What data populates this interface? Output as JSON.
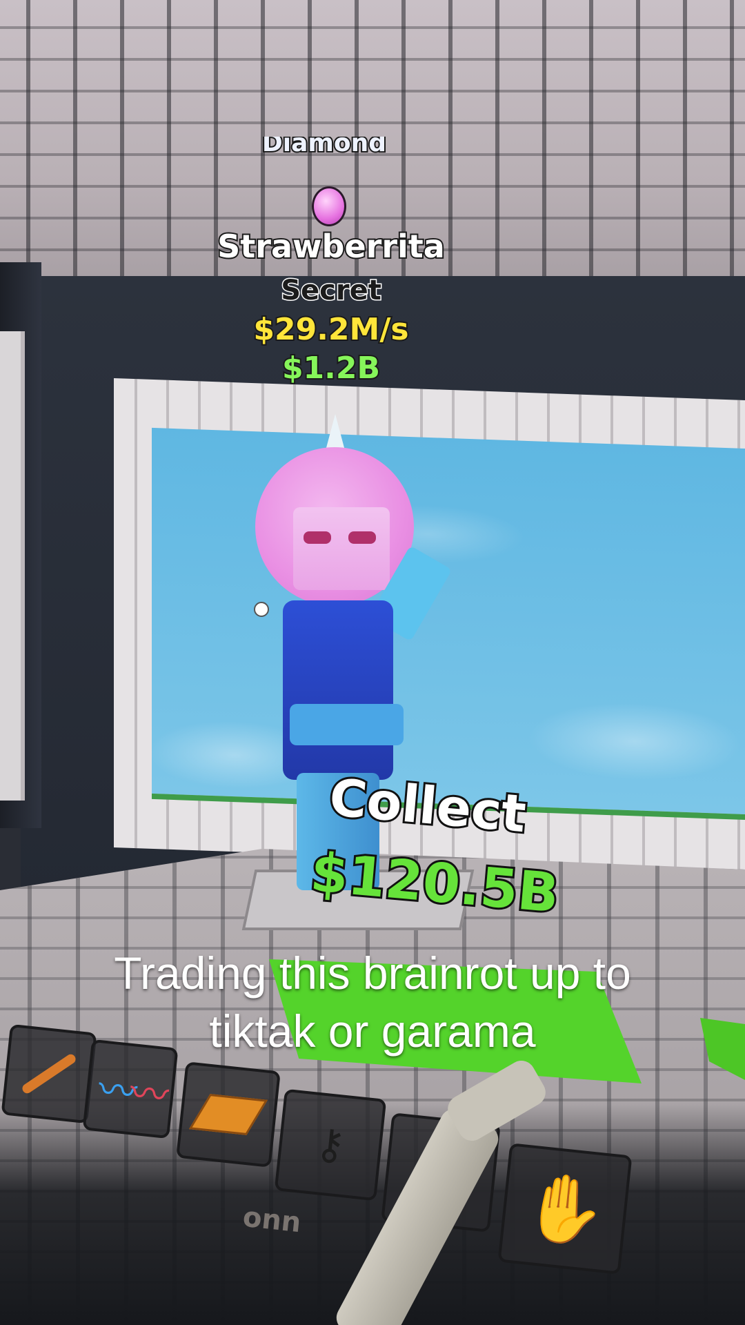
{
  "overhead_label": {
    "title_partial": "Diamond",
    "name": "Strawberrita",
    "rarity": "Secret",
    "rate": "$29.2M/s",
    "price": "$1.2B"
  },
  "collect_label": {
    "title": "Collect",
    "amount": "$120.5B"
  },
  "caption": {
    "line1": "Trading this brainrot up to",
    "line2": "tiktak or garama"
  },
  "hotbar": [
    {
      "icon": "bat-icon"
    },
    {
      "icon": "coils-icon"
    },
    {
      "icon": "table-icon"
    },
    {
      "icon": "key-icon"
    },
    {
      "icon": "gem-icon"
    },
    {
      "icon": "hand-icon"
    }
  ],
  "monitor_brand": "onn",
  "colors": {
    "rate": "#ffe53a",
    "price": "#86f55a",
    "collect_amount": "#66e33a",
    "character_head": "#e98fe3",
    "character_body": "#2d4fd6",
    "pad": "#54d32b",
    "sky": "#5fb7e2"
  }
}
